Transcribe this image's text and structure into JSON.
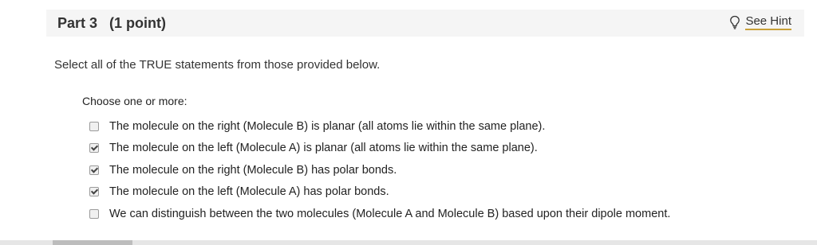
{
  "part": {
    "title": "Part 3   (1 point)",
    "hint_label": "See Hint",
    "hint_icon": "lightbulb-icon"
  },
  "question": {
    "instructions": "Select all of the TRUE statements from those provided below.",
    "choose_label": "Choose one or more:",
    "options": [
      {
        "text": "The molecule on the right (Molecule B) is planar (all atoms lie within the same plane).",
        "checked": false
      },
      {
        "text": "The molecule on the left (Molecule A) is planar (all atoms lie within the same plane).",
        "checked": true
      },
      {
        "text": "The molecule on the right (Molecule B) has polar bonds.",
        "checked": true
      },
      {
        "text": "The molecule on the left (Molecule A) has polar bonds.",
        "checked": true
      },
      {
        "text": "We can distinguish between the two molecules (Molecule A and Molecule B) based upon their dipole moment.",
        "checked": false
      }
    ]
  },
  "colors": {
    "header_bg": "#f5f5f5",
    "hint_underline": "#c8a038",
    "text": "#333333"
  }
}
